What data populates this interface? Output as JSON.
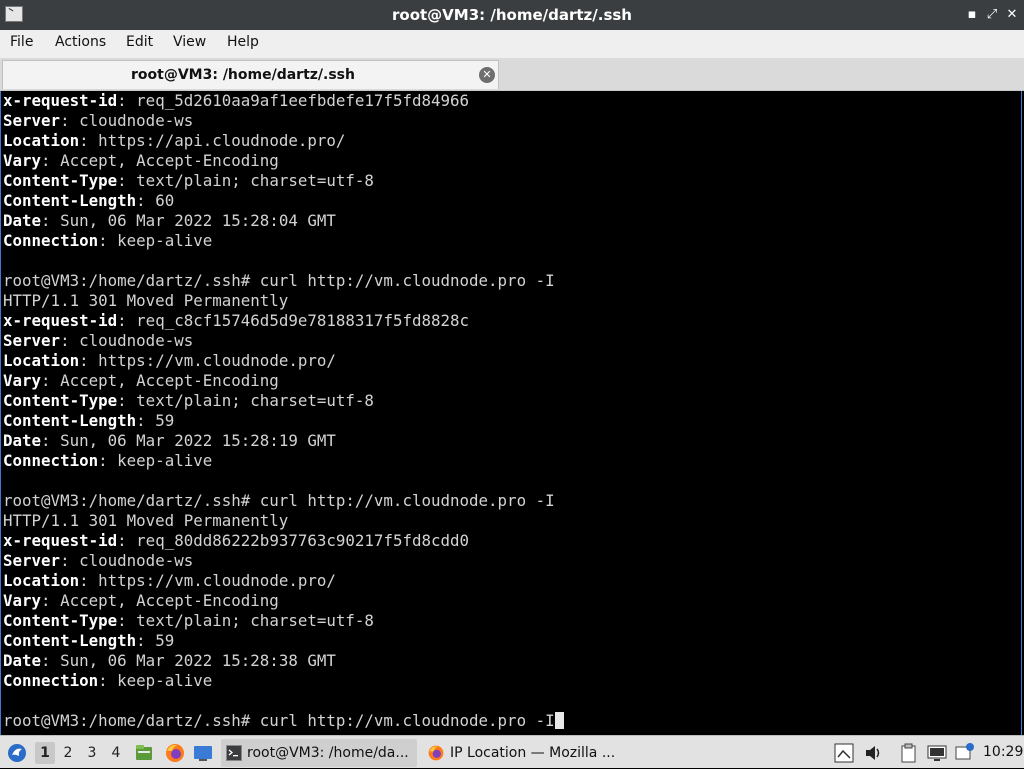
{
  "window": {
    "title": "root@VM3: /home/dartz/.ssh",
    "controls": {
      "minimize": "▪",
      "maximize": "⤢",
      "close": "✕"
    }
  },
  "menu": [
    "File",
    "Actions",
    "Edit",
    "View",
    "Help"
  ],
  "tab": {
    "label": "root@VM3: /home/dartz/.ssh",
    "close": "✕"
  },
  "terminal": {
    "lines": [
      {
        "k": "x-request-id",
        "v": "req_5d2610aa9af1eefbdefe17f5fd84966"
      },
      {
        "k": "Server",
        "v": "cloudnode-ws"
      },
      {
        "k": "Location",
        "v": "https://api.cloudnode.pro/"
      },
      {
        "k": "Vary",
        "v": "Accept, Accept-Encoding"
      },
      {
        "k": "Content-Type",
        "v": "text/plain; charset=utf-8"
      },
      {
        "k": "Content-Length",
        "v": "60"
      },
      {
        "k": "Date",
        "v": "Sun, 06 Mar 2022 15:28:04 GMT"
      },
      {
        "k": "Connection",
        "v": "keep-alive"
      },
      {
        "t": ""
      },
      {
        "t": "root@VM3:/home/dartz/.ssh# curl http://vm.cloudnode.pro -I"
      },
      {
        "t": "HTTP/1.1 301 Moved Permanently"
      },
      {
        "k": "x-request-id",
        "v": "req_c8cf15746d5d9e78188317f5fd8828c"
      },
      {
        "k": "Server",
        "v": "cloudnode-ws"
      },
      {
        "k": "Location",
        "v": "https://vm.cloudnode.pro/"
      },
      {
        "k": "Vary",
        "v": "Accept, Accept-Encoding"
      },
      {
        "k": "Content-Type",
        "v": "text/plain; charset=utf-8"
      },
      {
        "k": "Content-Length",
        "v": "59"
      },
      {
        "k": "Date",
        "v": "Sun, 06 Mar 2022 15:28:19 GMT"
      },
      {
        "k": "Connection",
        "v": "keep-alive"
      },
      {
        "t": ""
      },
      {
        "t": "root@VM3:/home/dartz/.ssh# curl http://vm.cloudnode.pro -I"
      },
      {
        "t": "HTTP/1.1 301 Moved Permanently"
      },
      {
        "k": "x-request-id",
        "v": "req_80dd86222b937763c90217f5fd8cdd0"
      },
      {
        "k": "Server",
        "v": "cloudnode-ws"
      },
      {
        "k": "Location",
        "v": "https://vm.cloudnode.pro/"
      },
      {
        "k": "Vary",
        "v": "Accept, Accept-Encoding"
      },
      {
        "k": "Content-Type",
        "v": "text/plain; charset=utf-8"
      },
      {
        "k": "Content-Length",
        "v": "59"
      },
      {
        "k": "Date",
        "v": "Sun, 06 Mar 2022 15:28:38 GMT"
      },
      {
        "k": "Connection",
        "v": "keep-alive"
      },
      {
        "t": ""
      },
      {
        "t": "root@VM3:/home/dartz/.ssh# curl http://vm.cloudnode.pro -I",
        "cursor": true
      }
    ]
  },
  "taskbar": {
    "workspaces": [
      "1",
      "2",
      "3",
      "4"
    ],
    "active_workspace": "1",
    "tasks": [
      {
        "label": "root@VM3: /home/da...",
        "icon": "terminal-icon",
        "active": true
      },
      {
        "label": "IP Location — Mozilla ...",
        "icon": "firefox-icon",
        "active": false
      }
    ],
    "clock": "10:29"
  },
  "colors": {
    "titlebar": "#3b3e40",
    "accent": "#3a7bd5",
    "terminal_bg": "#000000",
    "terminal_fg": "#d3d3d3"
  }
}
